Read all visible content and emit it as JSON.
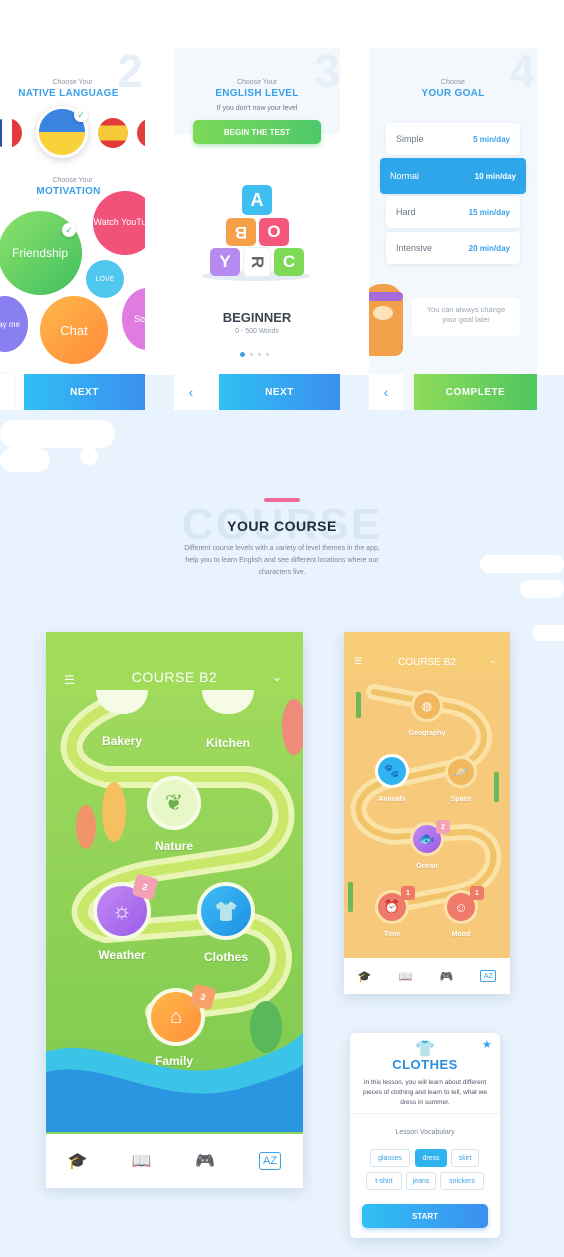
{
  "colors": {
    "accent": "#3aa0e8",
    "green": "#7ed957",
    "pink": "#f06a9a",
    "sand": "#f7c97a"
  },
  "step2": {
    "num": "2",
    "choose_native": "Choose Your",
    "native_title": "NATIVE LANGUAGE",
    "choose_motivation": "Choose Your",
    "motivation_title": "MOTIVATION",
    "bubbles": {
      "friendship": "Friendship",
      "watch": "Watch YouTube",
      "love": "LOVE",
      "chat": "Chat",
      "play": "ay me",
      "so": "So"
    },
    "next": "NEXT"
  },
  "step3": {
    "num": "3",
    "choose": "Choose Your",
    "title": "ENGLISH LEVEL",
    "subtitle": "If you don't now your level",
    "test_button": "BEGIN THE TEST",
    "blocks": [
      "A",
      "B",
      "O",
      "Y",
      "R",
      "C"
    ],
    "level": "BEGINNER",
    "words": "0 - 500 Words",
    "back": "‹",
    "next": "NEXT"
  },
  "step4": {
    "num": "4",
    "choose": "Choose",
    "title": "YOUR GOAL",
    "goals": [
      {
        "name": "Simple",
        "value": "5 min/day"
      },
      {
        "name": "Normal",
        "value": "10 min/day"
      },
      {
        "name": "Hard",
        "value": "15 min/day"
      },
      {
        "name": "Intensive",
        "value": "20 min/day"
      }
    ],
    "tip": "You can always change your goal later",
    "back": "‹",
    "complete": "COMPLETE"
  },
  "section": {
    "bg_word": "COURSE",
    "title": "YOUR COURSE",
    "desc": "Different course levels with a variety of level themes in the app, help you to learn English and see different locations where our characters live."
  },
  "course_green": {
    "header": "COURSE B2",
    "nodes": {
      "bakery": "Bakery",
      "kitchen": "Kitchen",
      "nature": "Nature",
      "weather": "Weather",
      "clothes": "Clothes",
      "family": "Family"
    },
    "badges": {
      "weather": "2",
      "family": "3"
    }
  },
  "course_sand": {
    "header": "COURSE B2",
    "nodes": {
      "geography": "Geography",
      "animals": "Animals",
      "space": "Space",
      "ocean": "Ocean",
      "time": "Time",
      "mood": "Mood"
    },
    "badges": {
      "ocean": "2",
      "time": "1",
      "mood": "1"
    }
  },
  "lesson": {
    "title": "CLOTHES",
    "desc": "In this lesson, you will learn about different pieces of clothing and learn to tell, what we dress in summer.",
    "vocab_label": "Lesson Vocabulary",
    "chips": [
      "glasses",
      "dress",
      "skirt",
      "t-shirt",
      "jeans",
      "snickers"
    ],
    "start": "START"
  }
}
